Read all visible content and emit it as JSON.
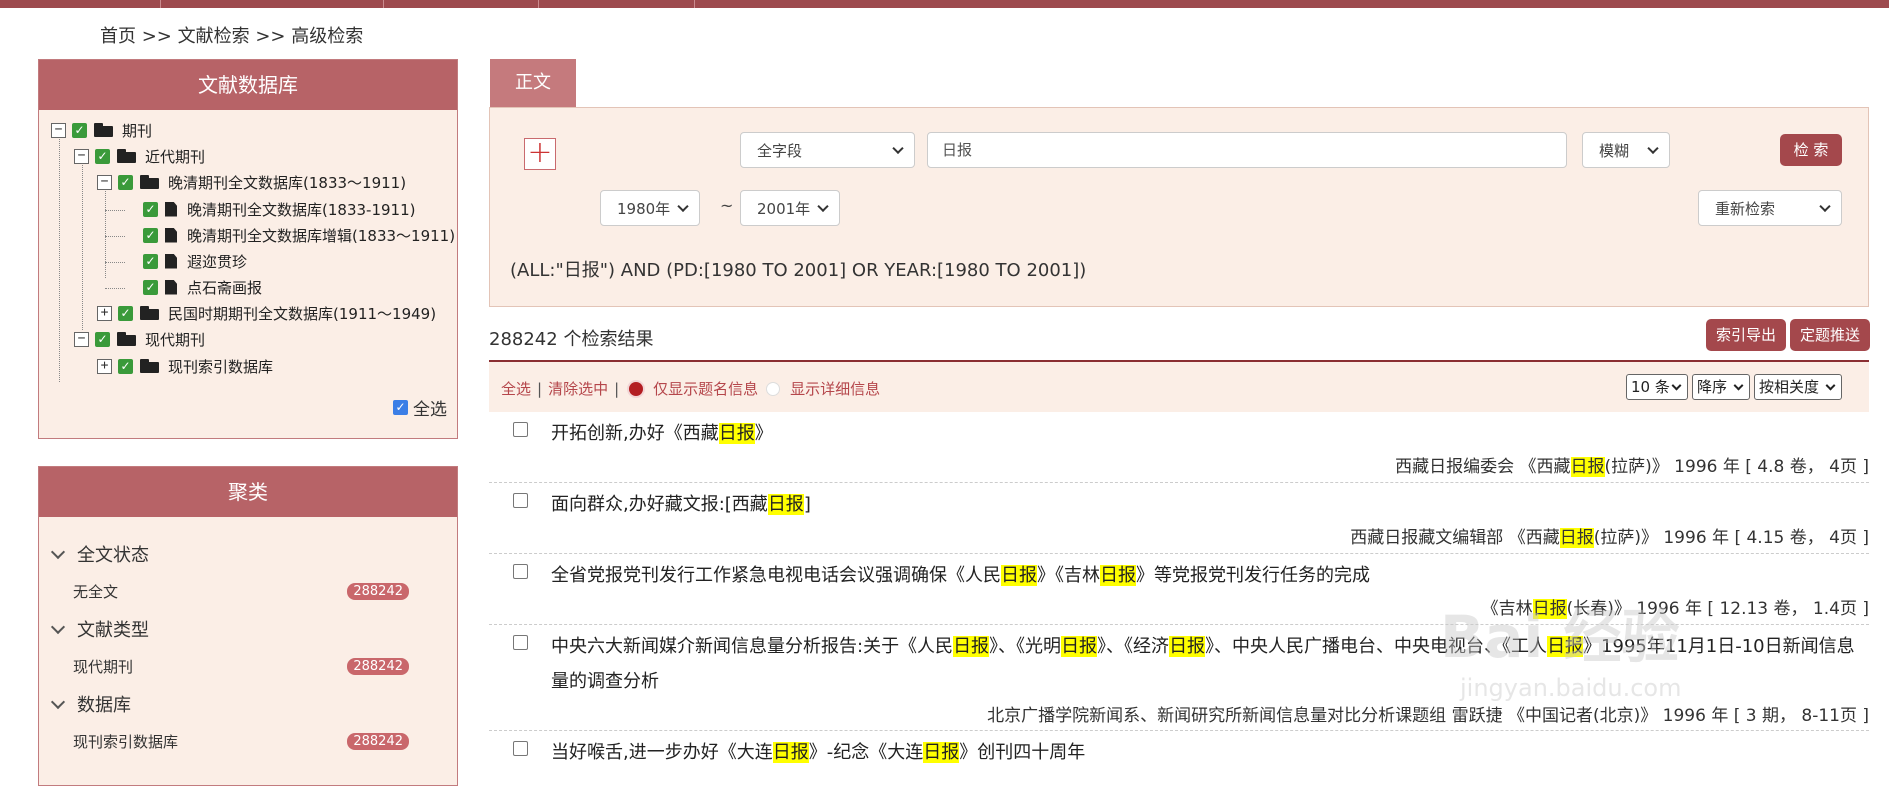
{
  "breadcrumb": "首页 >> 文献检索 >> 高级检索",
  "db_panel": {
    "title": "文献数据库",
    "tree": [
      {
        "label": "期刊",
        "expander": "−",
        "icon": "folder-open"
      },
      {
        "label": "近代期刊",
        "expander": "−",
        "icon": "folder-open"
      },
      {
        "label": "晚清期刊全文数据库(1833～1911)",
        "expander": "−",
        "icon": "folder-open"
      },
      {
        "label": "晚清期刊全文数据库(1833-1911)",
        "expander": "",
        "icon": "file"
      },
      {
        "label": "晚清期刊全文数据库增辑(1833～1911)",
        "expander": "",
        "icon": "file"
      },
      {
        "label": "遐迩贯珍",
        "expander": "",
        "icon": "file"
      },
      {
        "label": "点石斋画报",
        "expander": "",
        "icon": "file"
      },
      {
        "label": "民国时期期刊全文数据库(1911～1949)",
        "expander": "+",
        "icon": "folder"
      },
      {
        "label": "现代期刊",
        "expander": "−",
        "icon": "folder-open"
      },
      {
        "label": "现刊索引数据库",
        "expander": "+",
        "icon": "folder"
      }
    ],
    "select_all": "全选"
  },
  "cluster_panel": {
    "title": "聚类",
    "groups": [
      {
        "label": "全文状态",
        "item": "无全文",
        "count": "288242"
      },
      {
        "label": "文献类型",
        "item": "现代期刊",
        "count": "288242"
      },
      {
        "label": "数据库",
        "item": "现刊索引数据库",
        "count": "288242"
      }
    ]
  },
  "search": {
    "tab": "正文",
    "add_symbol": "+",
    "field": "全字段",
    "keyword": "日报",
    "match": "模糊",
    "search_button": "检 索",
    "year_from": "1980年",
    "range_sep": "~",
    "year_to": "2001年",
    "refine": "重新检索",
    "query": "(ALL:\"日报\") AND (PD:[1980 TO 2001] OR YEAR:[1980 TO 2001])"
  },
  "results_header": {
    "count": "288242",
    "count_suffix": "个检索结果",
    "export_button": "索引导出",
    "push_button": "定题推送"
  },
  "toolbar": {
    "select_all": "全选",
    "clear": "清除选中",
    "title_only": "仅显示题名信息",
    "detail": "显示详细信息",
    "page_size": "10 条",
    "order": "降序",
    "sort_by": "按相关度"
  },
  "results": [
    {
      "title": [
        "开拓创新,办好《西藏",
        "日报",
        "》"
      ],
      "meta": [
        "西藏日报编委会 《西藏",
        "日报",
        "(拉萨)》 1996 年 [ 4.8 卷， 4页 ]"
      ]
    },
    {
      "title": [
        "面向群众,办好藏文报:[西藏",
        "日报",
        "]"
      ],
      "meta": [
        "西藏日报藏文编辑部 《西藏",
        "日报",
        "(拉萨)》 1996 年 [ 4.15 卷， 4页 ]"
      ]
    },
    {
      "title": [
        "全省党报党刊发行工作紧急电视电话会议强调确保《人民",
        "日报",
        "》《吉林",
        "日报",
        "》等党报党刊发行任务的完成"
      ],
      "meta": [
        "《吉林",
        "日报",
        "(长春)》 1996 年 [ 12.13 卷， 1.4页 ]"
      ]
    },
    {
      "title": [
        "中央六大新闻媒介新闻信息量分析报告:关于《人民",
        "日报",
        "》、《光明",
        "日报",
        "》、《经济",
        "日报",
        "》、中央人民广播电台、中央电视台、《工人",
        "日报",
        "》1995年11月1日-10日新闻信息量的调查分析"
      ],
      "meta": [
        "北京广播学院新闻系、新闻研究所新闻信息量对比分析课题组 雷跃捷 《中国记者(北京)》 1996 年 [ 3 期， 8-11页 ]"
      ]
    },
    {
      "title": [
        "当好喉舌,进一步办好《大连",
        "日报",
        "》-纪念《大连",
        "日报",
        "》创刊四十周年"
      ],
      "meta": []
    }
  ],
  "watermark": {
    "main": "Bai 经验",
    "sub": "jingyan.baidu.com"
  }
}
